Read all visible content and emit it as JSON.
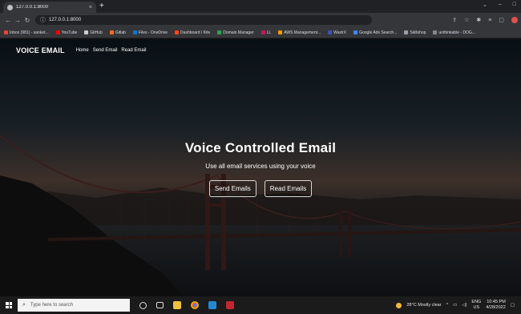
{
  "browser": {
    "tab_title": "127.0.0.1:8000",
    "tab_close": "×",
    "new_tab": "+",
    "url": "127.0.0.1:8000",
    "window_controls": [
      "⌄",
      "–",
      "□"
    ],
    "bookmarks": [
      {
        "label": "Inbox (981) - sanket...",
        "color": "#ea4335"
      },
      {
        "label": "YouTube",
        "color": "#ff0000"
      },
      {
        "label": "GitHub",
        "color": "#cccccc"
      },
      {
        "label": "Gitlab",
        "color": "#fc6d26"
      },
      {
        "label": "Files - OneDrive",
        "color": "#0078d4"
      },
      {
        "label": "Dashboard / Kite",
        "color": "#f6461a"
      },
      {
        "label": "Domain Manager",
        "color": "#2ea44f"
      },
      {
        "label": "LL",
        "color": "#c2185b"
      },
      {
        "label": "AWS Management...",
        "color": "#ff9900"
      },
      {
        "label": "WazirX",
        "color": "#3f51b5"
      },
      {
        "label": "Google Ads Search...",
        "color": "#4285f4"
      },
      {
        "label": "Skillshop",
        "color": "#9aa0a6"
      },
      {
        "label": "unthinkable - DOG...",
        "color": "#888888"
      }
    ]
  },
  "site": {
    "brand": "VOICE EMAIL",
    "nav": [
      "Home",
      "Send Email",
      "Read Email"
    ],
    "hero_title": "Voice Controlled Email",
    "hero_subtitle": "Use all email services using your voice",
    "buttons": [
      "Send Emails",
      "Read Emails"
    ]
  },
  "taskbar": {
    "search_placeholder": "Type here to search",
    "weather": "28°C Mostly clear",
    "lang_top": "ENG",
    "lang_bottom": "US",
    "time": "10:45 PM",
    "date": "4/28/2022"
  },
  "colors": {
    "browser_dark": "#202124",
    "browser_toolbar": "#35363a",
    "taskbar": "#1b1b1b",
    "hero_text": "#ffffff"
  }
}
